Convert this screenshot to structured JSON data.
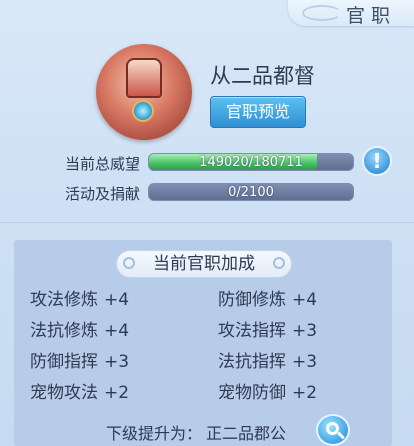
{
  "header": {
    "title": "官职"
  },
  "rank": {
    "name": "从二品都督",
    "preview_button": "官职预览",
    "emblem_icon": "helmet-emblem-icon"
  },
  "stats": {
    "prestige_label": "当前总威望",
    "prestige_text": "149020/180711",
    "prestige_current": 149020,
    "prestige_max": 180711,
    "activity_label": "活动及捐献",
    "activity_text": "0/2100",
    "activity_current": 0,
    "activity_max": 2100,
    "help_icon": "question-icon",
    "help_text": "!"
  },
  "bonus": {
    "title": "当前官职加成",
    "items": [
      {
        "name": "攻法修炼",
        "value": "+4"
      },
      {
        "name": "防御修炼",
        "value": "+4"
      },
      {
        "name": "法抗修炼",
        "value": "+4"
      },
      {
        "name": "攻法指挥",
        "value": "+3"
      },
      {
        "name": "防御指挥",
        "value": "+3"
      },
      {
        "name": "法抗指挥",
        "value": "+3"
      },
      {
        "name": "宠物攻法",
        "value": "+2"
      },
      {
        "name": "宠物防御",
        "value": "+2"
      }
    ]
  },
  "next": {
    "label": "下级提升为：",
    "value": "正二品郡公",
    "search_icon": "search-icon"
  },
  "colors": {
    "accent_blue": "#2f8fd3",
    "bar_green": "#4dc56a",
    "text_dark": "#2f3a52"
  }
}
